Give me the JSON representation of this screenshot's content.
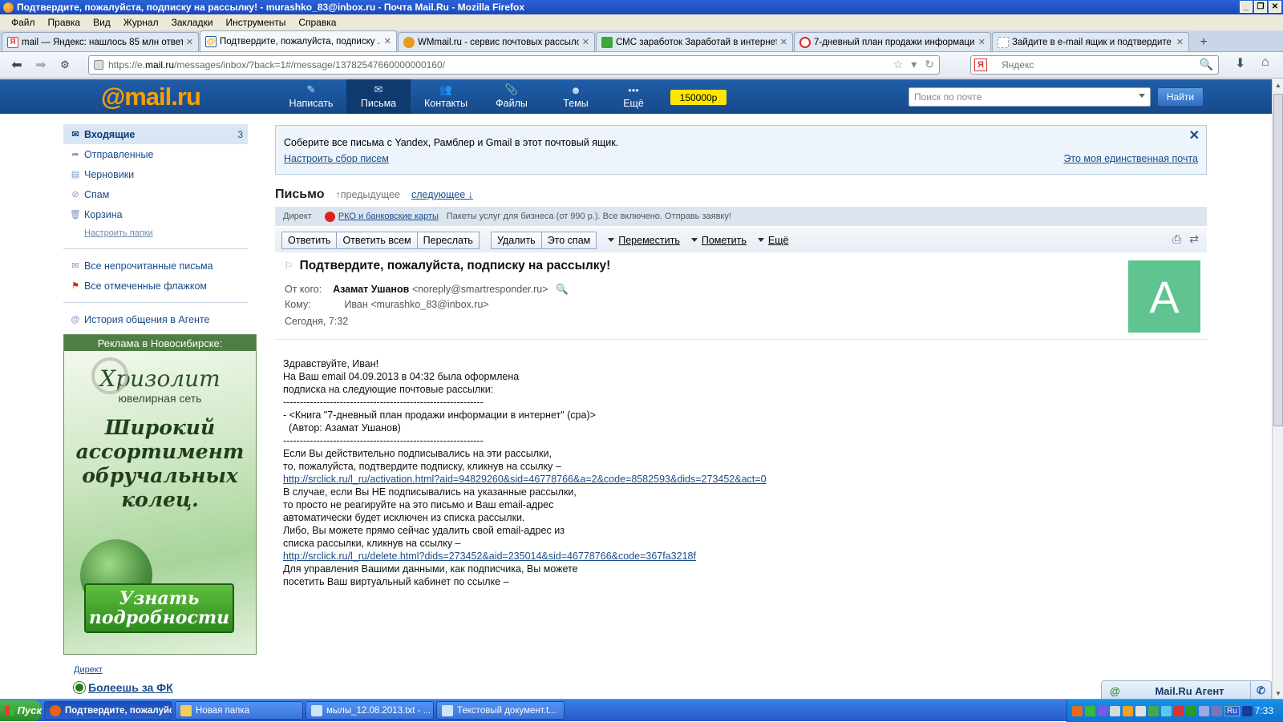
{
  "window": {
    "title": "Подтвердите, пожалуйста, подписку на рассылку! - murashko_83@inbox.ru - Почта Mail.Ru - Mozilla Firefox"
  },
  "menu": [
    "Файл",
    "Правка",
    "Вид",
    "Журнал",
    "Закладки",
    "Инструменты",
    "Справка"
  ],
  "tabs": [
    {
      "label": "mail — Яндекс: нашлось 85 млн ответов",
      "icon": "yandex-icon",
      "color": "#e03a2a"
    },
    {
      "label": "Подтвердите, пожалуйста, подписку ...",
      "icon": "mailru-icon",
      "color": "#1f5ea8"
    },
    {
      "label": "WMmail.ru - сервис почтовых рассылок...",
      "icon": "wmmail-icon",
      "color": "#e89a1a"
    },
    {
      "label": "СМС заработок Заработай в интернете",
      "icon": "puzzle-icon",
      "color": "#38a838"
    },
    {
      "label": "7-дневный план продажи информации ...",
      "icon": "opera-icon",
      "color": "#d9282a"
    },
    {
      "label": "Зайдите в e-mail ящик и подтвердите ...",
      "icon": "blank-page-icon",
      "color": "#ffffff"
    }
  ],
  "nav": {
    "url_prefix": "https://e.",
    "url_host": "mail.ru",
    "url_path": "/messages/inbox/?back=1#/message/13782547660000000160/",
    "search_placeholder": "Яндекс"
  },
  "mail_header": {
    "logo_at": "@mail",
    "logo_ru": ".ru",
    "nav": [
      {
        "label": "Написать",
        "icon": "pencil-icon"
      },
      {
        "label": "Письма",
        "icon": "envelope-icon"
      },
      {
        "label": "Контакты",
        "icon": "contacts-icon"
      },
      {
        "label": "Файлы",
        "icon": "paperclip-icon"
      },
      {
        "label": "Темы",
        "icon": "palette-icon"
      },
      {
        "label": "Ещё",
        "icon": "dots-icon"
      }
    ],
    "promo": "150000р",
    "search_placeholder": "Поиск по почте",
    "find_label": "Найти"
  },
  "sidebar": {
    "folders": [
      {
        "label": "Входящие",
        "count": "3",
        "icon": "envelope-icon"
      },
      {
        "label": "Отправленные",
        "icon": "send-arrow-icon"
      },
      {
        "label": "Черновики",
        "icon": "draft-icon"
      },
      {
        "label": "Спам",
        "icon": "spam-icon"
      },
      {
        "label": "Корзина",
        "icon": "trash-icon"
      }
    ],
    "folders_settings": "Настроить папки",
    "filters": [
      {
        "label": "Все непрочитанные письма",
        "icon": "unread-icon"
      },
      {
        "label": "Все отмеченные флажком",
        "icon": "red-flag-icon"
      }
    ],
    "agent_history": "История общения в Агенте"
  },
  "ad": {
    "header": "Реклама в Новосибирске:",
    "brand": "Хризолит",
    "network": "ювелирная сеть",
    "slogan": "Широкий ассортимент обручальных колец.",
    "button": "Узнать подробности"
  },
  "direkt_bottom": {
    "label": "Директ",
    "link": "Болеешь за ФК"
  },
  "collect_banner": {
    "text": "Соберите все письма с Yandex, Рамблер и Gmail в этот почтовый ящик.",
    "setup_link": "Настроить сбор писем",
    "only_link": "Это моя единственная почта"
  },
  "letter_nav": {
    "title": "Письмо",
    "prev": "↑предыдущее",
    "next": "следующее ↓"
  },
  "direkt": {
    "label": "Директ",
    "link": "РКО и банковские карты",
    "text": "Пакеты услуг для бизнеса (от 990 р.). Все включено. Отправь заявку!"
  },
  "toolbar": {
    "reply": "Ответить",
    "reply_all": "Ответить всем",
    "forward": "Переслать",
    "delete": "Удалить",
    "spam": "Это спам",
    "move": "Переместить",
    "mark": "Пометить",
    "more": "Ещё"
  },
  "message": {
    "subject": "Подтвердите, пожалуйста, подписку на рассылку!",
    "from_label": "От кого:",
    "from_name": "Азамат Ушанов",
    "from_email": "<noreply@smartresponder.ru>",
    "to_label": "Кому:",
    "to_value": "Иван <murashko_83@inbox.ru>",
    "date": "Сегодня, 7:32",
    "avatar_letter": "А",
    "avatar_color": "#5fc48f",
    "body": [
      {
        "t": "Здравствуйте, Иван!"
      },
      {
        "t": ""
      },
      {
        "t": "На Ваш email 04.09.2013 в 04:32 была оформлена"
      },
      {
        "t": "подписка на следующие почтовые рассылки:"
      },
      {
        "t": "------------------------------------------------------------"
      },
      {
        "t": "- <Книга \"7-дневный план продажи информации в интернет\" (сра)>"
      },
      {
        "t": "  (Автор: Азамат Ушанов)"
      },
      {
        "t": "------------------------------------------------------------"
      },
      {
        "t": ""
      },
      {
        "t": "Если Вы действительно подписывались на эти рассылки,"
      },
      {
        "t": "то, пожалуйста, подтвердите подписку, кликнув на ссылку –"
      },
      {
        "t": ""
      },
      {
        "t": "http://srclick.ru/l_ru/activation.html?aid=94829260&sid=46778766&a=2&code=8582593&dids=273452&act=0",
        "link": true
      },
      {
        "t": ""
      },
      {
        "t": ""
      },
      {
        "t": "В случае, если Вы НЕ подписывались на указанные рассылки,"
      },
      {
        "t": "то просто не реагируйте на это письмо и Ваш email-адрес"
      },
      {
        "t": "автоматически будет исключен из списка рассылки."
      },
      {
        "t": ""
      },
      {
        "t": "Либо, Вы можете прямо сейчас удалить свой email-адрес из"
      },
      {
        "t": "списка рассылки, кликнув на ссылку –"
      },
      {
        "t": ""
      },
      {
        "t": "http://srclick.ru/l_ru/delete.html?dids=273452&aid=235014&sid=46778766&code=367fa3218f",
        "link": true
      },
      {
        "t": ""
      },
      {
        "t": ""
      },
      {
        "t": "Для управления Вашими данными, как подписчика, Вы можете"
      },
      {
        "t": "посетить Ваш виртуальный кабинет по ссылке –"
      }
    ]
  },
  "agent_bar": {
    "label": "Mail.Ru Агент"
  },
  "taskbar": {
    "start": "Пуск",
    "tasks": [
      {
        "label": "Подтвердите, пожалуйста, ...",
        "icon": "firefox-icon",
        "color": "#e5631a"
      },
      {
        "label": "Новая папка",
        "icon": "folder-icon",
        "color": "#f2cf5b"
      },
      {
        "label": "мылы_12.08.2013.txt - ...",
        "icon": "notepad-icon",
        "color": "#cfe4f7"
      },
      {
        "label": "Текстовый документ.t...",
        "icon": "notepad-icon",
        "color": "#cfe4f7"
      }
    ],
    "lang": "Ru",
    "clock": "7:33"
  }
}
